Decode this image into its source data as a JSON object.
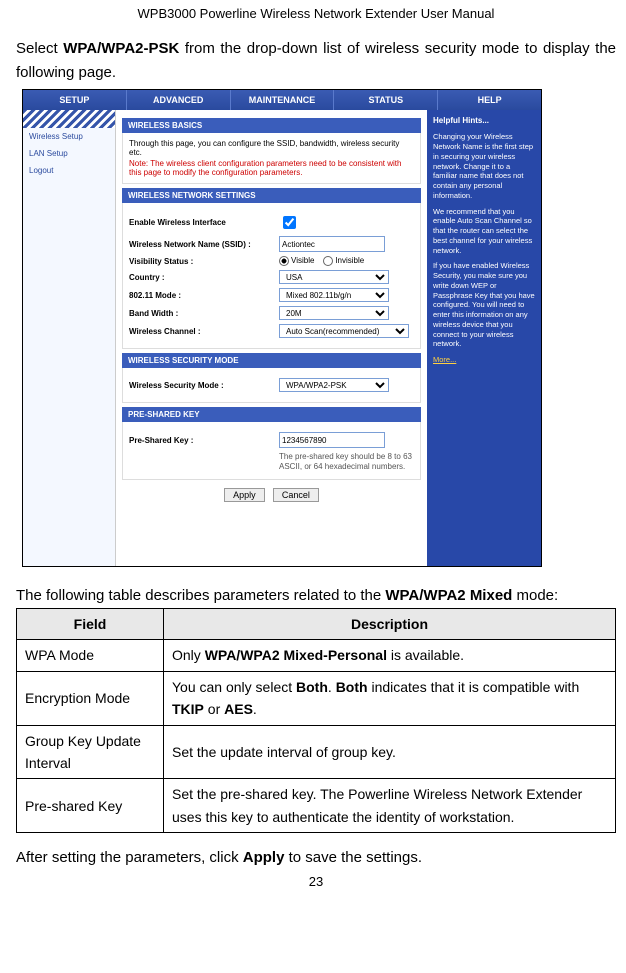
{
  "header": "WPB3000 Powerline Wireless Network Extender User Manual",
  "instruction_pre": "Select ",
  "instruction_bold": "WPA/WPA2-PSK",
  "instruction_post": " from the drop-down list of wireless security mode to display the following page.",
  "screenshot": {
    "tabs": [
      "SETUP",
      "ADVANCED",
      "MAINTENANCE",
      "STATUS",
      "HELP"
    ],
    "sidebar": [
      "Wireless Setup",
      "LAN Setup",
      "Logout"
    ],
    "panel_basics_title": "WIRELESS BASICS",
    "panel_basics_text": "Through this page, you can configure the SSID, bandwidth, wireless security etc.",
    "panel_basics_note": "Note: The wireless client configuration parameters need to be consistent with this page to modify the configuration parameters.",
    "panel_net_title": "WIRELESS NETWORK SETTINGS",
    "rows": {
      "enable": "Enable Wireless Interface",
      "ssid": "Wireless Network Name (SSID) :",
      "ssid_val": "Actiontec",
      "visibility": "Visibility Status :",
      "vis_visible": "Visible",
      "vis_invisible": "Invisible",
      "country": "Country :",
      "country_val": "USA",
      "mode": "802.11 Mode :",
      "mode_val": "Mixed 802.11b/g/n",
      "bw": "Band Width :",
      "bw_val": "20M",
      "channel": "Wireless Channel :",
      "channel_val": "Auto Scan(recommended)"
    },
    "panel_sec_title": "WIRELESS SECURITY MODE",
    "sec_label": "Wireless Security Mode :",
    "sec_val": "WPA/WPA2-PSK",
    "panel_psk_title": "PRE-SHARED KEY",
    "psk_label": "Pre-Shared Key :",
    "psk_val": "1234567890",
    "psk_hint": "The pre-shared key should be 8 to 63 ASCII, or 64 hexadecimal numbers.",
    "btn_apply": "Apply",
    "btn_cancel": "Cancel",
    "help": {
      "title": "Helpful Hints...",
      "p1": "Changing your Wireless Network Name is the first step in securing your wireless network. Change it to a familiar name that does not contain any personal information.",
      "p2": "We recommend that you enable Auto Scan Channel so that the router can select the best channel for your wireless network.",
      "p3": "If you have enabled Wireless Security, you make sure you write down WEP or Passphrase Key that you have configured. You will need to enter this information on any wireless device that you connect to your wireless network.",
      "more": "More..."
    }
  },
  "mid_text_pre": "The following table describes parameters related to the ",
  "mid_text_bold": "WPA/WPA2 Mixed",
  "mid_text_post": " mode:",
  "table": {
    "h1": "Field",
    "h2": "Description",
    "rows": [
      {
        "field": "WPA Mode",
        "desc_pre": "Only ",
        "desc_b1": "WPA/WPA2 Mixed-Personal",
        "desc_post": " is available."
      },
      {
        "field": "Encryption Mode",
        "desc_pre": "You can only select ",
        "desc_b1": "Both",
        "desc_mid": ". ",
        "desc_b2": "Both",
        "desc_mid2": " indicates that it is compatible with ",
        "desc_b3": "TKIP",
        "desc_mid3": " or ",
        "desc_b4": "AES",
        "desc_post": "."
      },
      {
        "field": "Group Key Update Interval",
        "desc": "Set the update interval of group key."
      },
      {
        "field": "Pre-shared Key",
        "desc": "Set the pre-shared key. The Powerline Wireless Network Extender uses this key to authenticate the identity of workstation."
      }
    ]
  },
  "after_pre": "After setting the parameters, click ",
  "after_bold": "Apply",
  "after_post": " to save the settings.",
  "pagenum": "23"
}
